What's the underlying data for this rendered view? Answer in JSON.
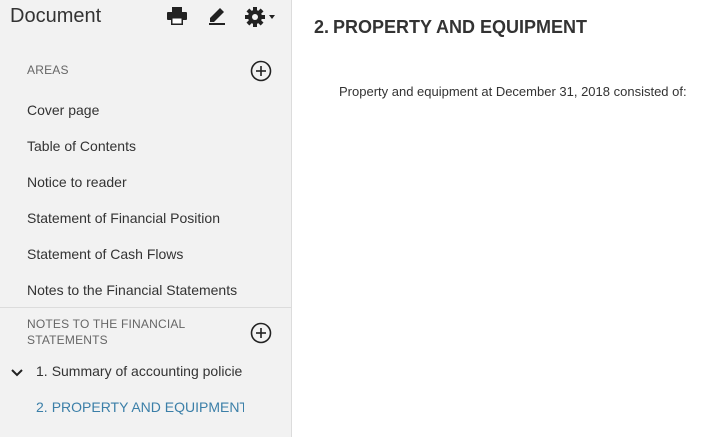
{
  "sidebar": {
    "title": "Document",
    "toolbar": {
      "print_icon": "print-icon",
      "edit_icon": "pencil-icon",
      "settings_icon": "gear-icon"
    },
    "areas": {
      "label": "AREAS",
      "items": [
        {
          "label": "Cover page"
        },
        {
          "label": "Table of Contents"
        },
        {
          "label": "Notice to reader"
        },
        {
          "label": "Statement of Financial Position"
        },
        {
          "label": "Statement of Cash Flows"
        },
        {
          "label": "Notes to the Financial Statements"
        }
      ]
    },
    "notes": {
      "label_line1": "NOTES TO THE FINANCIAL",
      "label_line2": "STATEMENTS",
      "items": [
        {
          "number": "1.",
          "label": "Summary of accounting policie",
          "expanded": true
        },
        {
          "number": "2.",
          "label": "PROPERTY AND EQUIPMENT",
          "active": true
        }
      ]
    }
  },
  "content": {
    "heading_number": "2.",
    "heading": "PROPERTY AND EQUIPMENT",
    "body": "Property and equipment at December 31, 2018 consisted of:"
  },
  "colors": {
    "accent": "#3b7fa8",
    "sidebar_bg": "#f2f2f2",
    "text": "#333333"
  }
}
